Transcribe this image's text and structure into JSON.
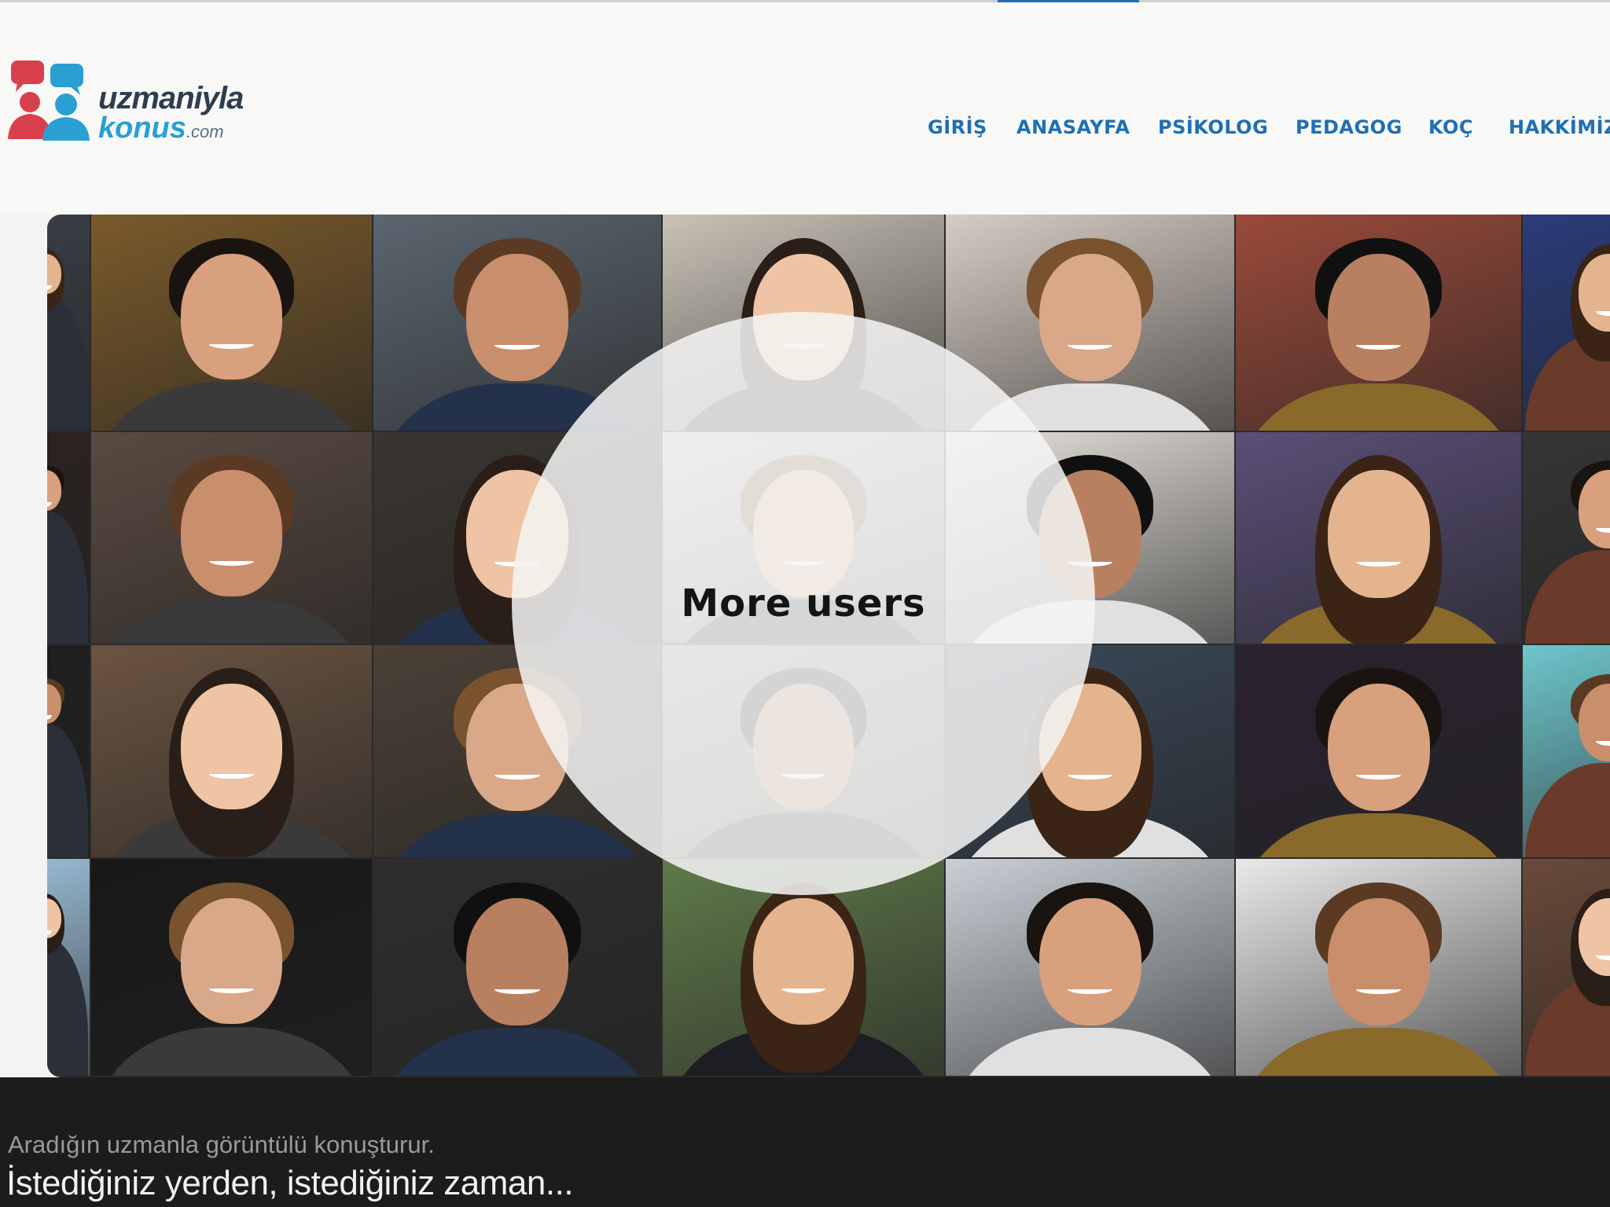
{
  "logo": {
    "line1": "uzmaniyla",
    "line2": "konus",
    "suffix": ".com"
  },
  "nav": {
    "items": [
      {
        "label": "GİRİŞ"
      },
      {
        "label": "ANASAYFA"
      },
      {
        "label": "PSİKOLOG"
      },
      {
        "label": "PEDAGOG"
      },
      {
        "label": "KOÇ"
      },
      {
        "label": "HAKKİMİZD"
      }
    ]
  },
  "overlay": {
    "label": "More users"
  },
  "footer": {
    "line1": "Aradığın uzmanla görüntülü konuşturur.",
    "line2": "İstediğiniz yerden, istediğiniz zaman..."
  },
  "colors": {
    "accent": "#1f6fb3",
    "logo_red": "#d9404e",
    "logo_blue": "#2a9fd2",
    "footer_bg": "#1c1c1c"
  }
}
